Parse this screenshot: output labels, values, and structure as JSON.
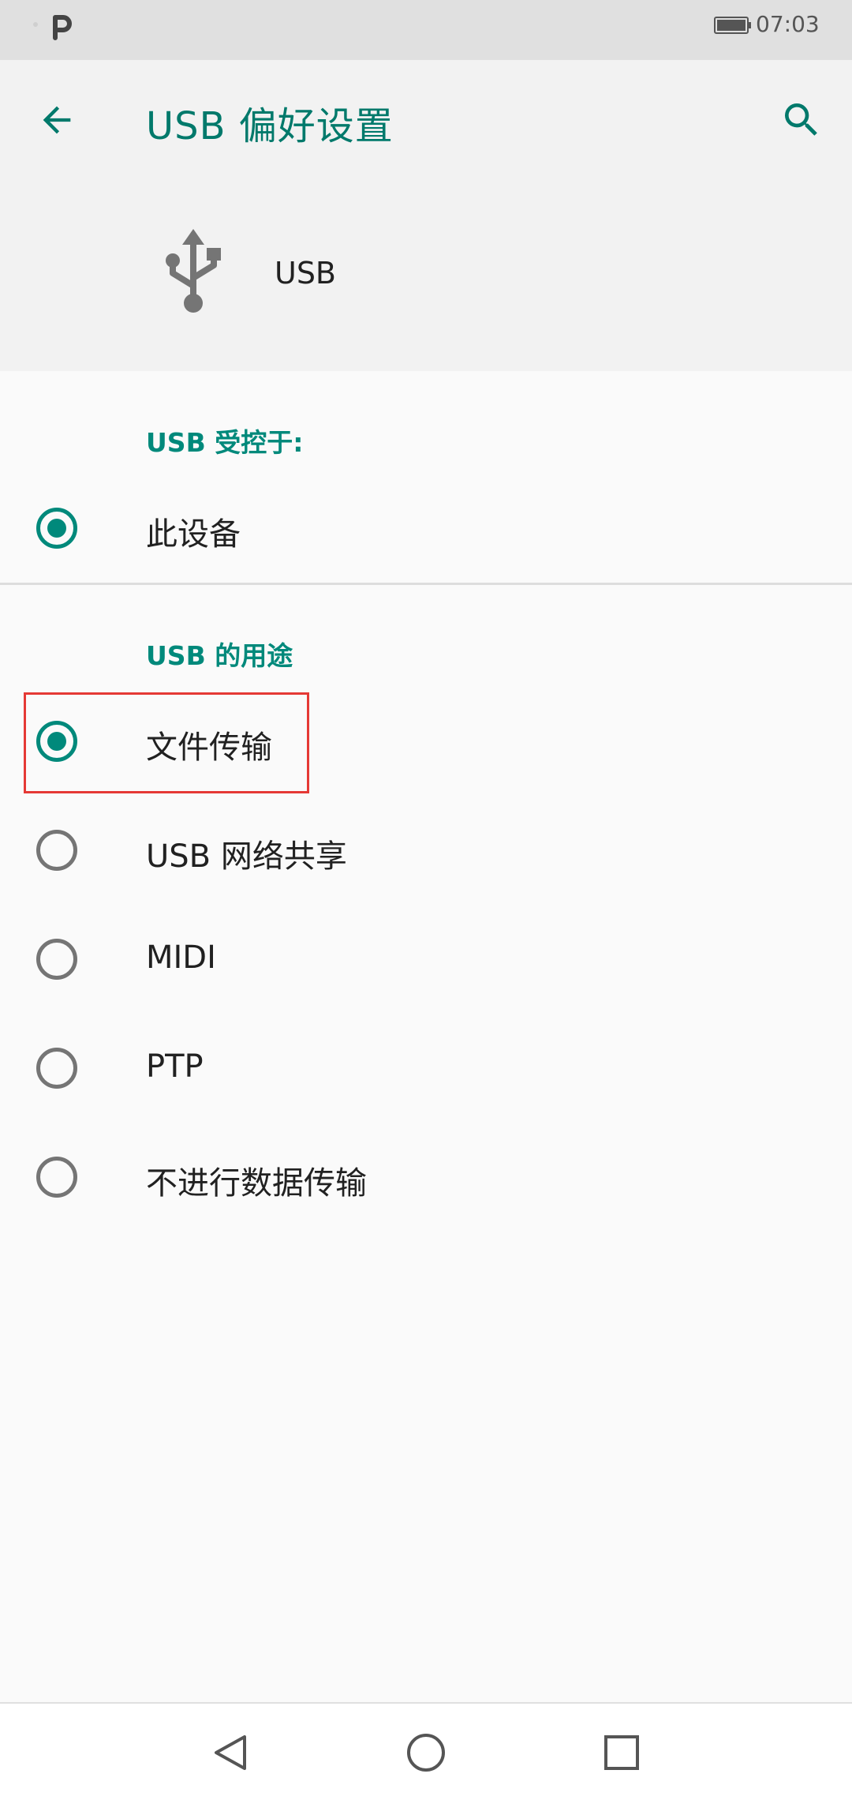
{
  "status_bar": {
    "time": "07:03"
  },
  "app_bar": {
    "title": "USB 偏好设置",
    "back_icon": "arrow-back-icon",
    "search_icon": "search-icon"
  },
  "header": {
    "icon": "usb-icon",
    "label": "USB"
  },
  "controlled_by": {
    "title": "USB 受控于:",
    "options": [
      {
        "label": "此设备",
        "selected": true
      }
    ]
  },
  "usb_use": {
    "title": "USB 的用途",
    "options": [
      {
        "label": "文件传输",
        "selected": true
      },
      {
        "label": "USB 网络共享",
        "selected": false
      },
      {
        "label": "MIDI",
        "selected": false
      },
      {
        "label": "PTP",
        "selected": false
      },
      {
        "label": "不进行数据传输",
        "selected": false
      }
    ]
  },
  "colors": {
    "accent": "#00897b",
    "title": "#00796b",
    "highlight": "#e53935"
  }
}
